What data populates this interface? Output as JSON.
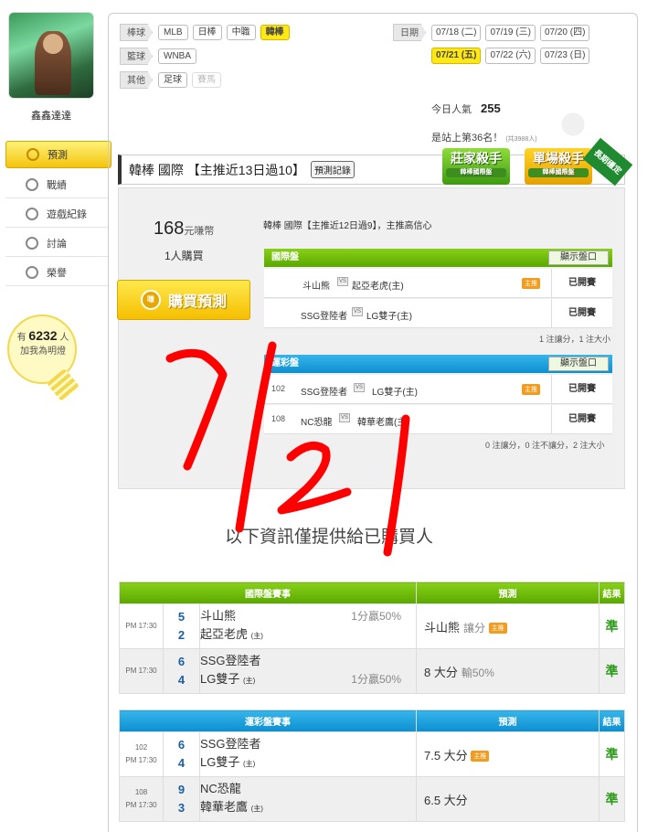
{
  "user": {
    "name": "鑫鑫達達"
  },
  "sidebar": {
    "items": [
      {
        "label": "預測"
      },
      {
        "label": "戰績"
      },
      {
        "label": "遊戲紀錄"
      },
      {
        "label": "討論"
      },
      {
        "label": "榮譽"
      }
    ]
  },
  "fans": {
    "prefix": "有",
    "count": "6232",
    "unit": "人",
    "suffix": "加我為明燈"
  },
  "filters": {
    "baseball_label": "棒球",
    "baseball": [
      "MLB",
      "日棒",
      "中職",
      "韓棒"
    ],
    "basketball_label": "籃球",
    "basketball": [
      "WNBA"
    ],
    "other_label": "其他",
    "other": [
      "足球",
      "賽馬"
    ],
    "date_label": "日期",
    "dates_row1": [
      "07/18 (二)",
      "07/19 (三)",
      "07/20 (四)"
    ],
    "dates_row2": [
      "07/21 (五)",
      "07/22 (六)",
      "07/23 (日)"
    ]
  },
  "stats": {
    "pop_label": "今日人氣",
    "pop_value": "255",
    "rank": "是站上第36名！",
    "rank_note": "(共3988人)"
  },
  "title": {
    "text": "韓棒 國際 【主推近13日過10】",
    "record_btn": "預測記錄"
  },
  "badges": {
    "b1": "莊家殺手",
    "b1_sub": "韓棒國際盤",
    "b2": "單場殺手",
    "b2_sub": "韓棒國際盤",
    "ribbon": "長期穩定"
  },
  "purchase": {
    "price": "168",
    "unit": "元嗛幣",
    "buyers": "1人購買",
    "button": "購買預測",
    "coin": "嗛",
    "desc": "韓棒 國際【主推近12日過9】，主推高信心"
  },
  "intl": {
    "header": "國際盤",
    "show": "顯示盤口",
    "rows": [
      {
        "num": "",
        "away": "斗山熊",
        "home": "起亞老虎(主)",
        "host": "主推",
        "state": "已開賽"
      },
      {
        "num": "",
        "away": "SSG登陸者",
        "home": "LG雙子(主)",
        "host": "",
        "state": "已開賽"
      }
    ],
    "note": "1 注讓分，1 注大小"
  },
  "lottery": {
    "header": "運彩盤",
    "show": "顯示盤口",
    "rows": [
      {
        "num": "102",
        "away": "SSG登陸者",
        "home": "LG雙子(主)",
        "host": "主推",
        "state": "已開賽"
      },
      {
        "num": "108",
        "away": "NC恐龍",
        "home": "韓華老鷹(主)",
        "host": "",
        "state": "已開賽"
      }
    ],
    "note": "0 注讓分，0 注不讓分，2 注大小"
  },
  "info_text": "以下資訊僅提供給已購買人",
  "table1": {
    "h1": "國際盤賽事",
    "h2": "預測",
    "h3": "結果",
    "rows": [
      {
        "no": "",
        "time": "PM 17:30",
        "s1": "5",
        "t1": "斗山熊",
        "s2": "2",
        "t2": "起亞老虎",
        "host": "(主)",
        "odd1": "1分贏50%",
        "odd2": "",
        "pred": "斗山熊",
        "pred_g": "讓分",
        "pred_host": "主推",
        "result": "準"
      },
      {
        "no": "",
        "time": "PM 17:30",
        "s1": "6",
        "t1": "SSG登陸者",
        "s2": "4",
        "t2": "LG雙子",
        "host": "(主)",
        "odd1": "",
        "odd2": "1分贏50%",
        "pred": "8 大分",
        "pred_g": "輸50%",
        "pred_host": "",
        "result": "準"
      }
    ]
  },
  "table2": {
    "h1": "運彩盤賽事",
    "h2": "預測",
    "h3": "結果",
    "rows": [
      {
        "no": "102",
        "time": "PM 17:30",
        "s1": "6",
        "t1": "SSG登陸者",
        "s2": "4",
        "t2": "LG雙子",
        "host": "(主)",
        "pred": "7.5 大分",
        "pred_host": "主推",
        "result": "準"
      },
      {
        "no": "108",
        "time": "PM 17:30",
        "s1": "9",
        "t1": "NC恐龍",
        "s2": "3",
        "t2": "韓華老鷹",
        "host": "(主)",
        "pred": "6.5 大分",
        "pred_host": "",
        "result": "準"
      }
    ]
  },
  "handwriting": "7/21",
  "colors": {
    "accent": "#ffe816",
    "green": "#5aa700",
    "blue": "#0d8fd0",
    "handwriting": "#ff0000",
    "result": "#2a9a18"
  }
}
